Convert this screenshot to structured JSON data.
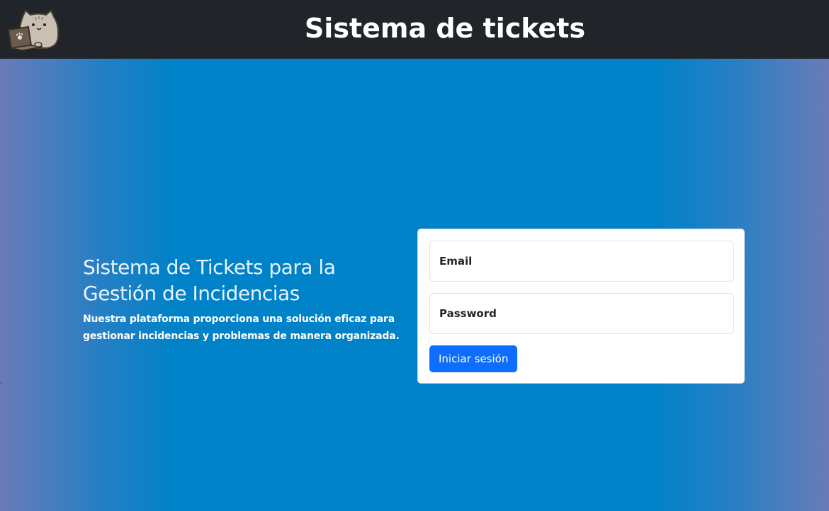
{
  "navbar": {
    "title": "Sistema de tickets",
    "logo_icon": "cat-with-laptop-icon",
    "background": "#212529"
  },
  "hero": {
    "heading": "Sistema de Tickets para la Gestión de Incidencias",
    "description": "Nuestra plataforma proporciona una solución eficaz para gestionar incidencias y problemas de manera organizada.",
    "stray_mark": "´"
  },
  "login_form": {
    "email_placeholder": "Email",
    "password_placeholder": "Password",
    "submit_label": "Iniciar sesión",
    "button_color": "#0d6efd"
  }
}
